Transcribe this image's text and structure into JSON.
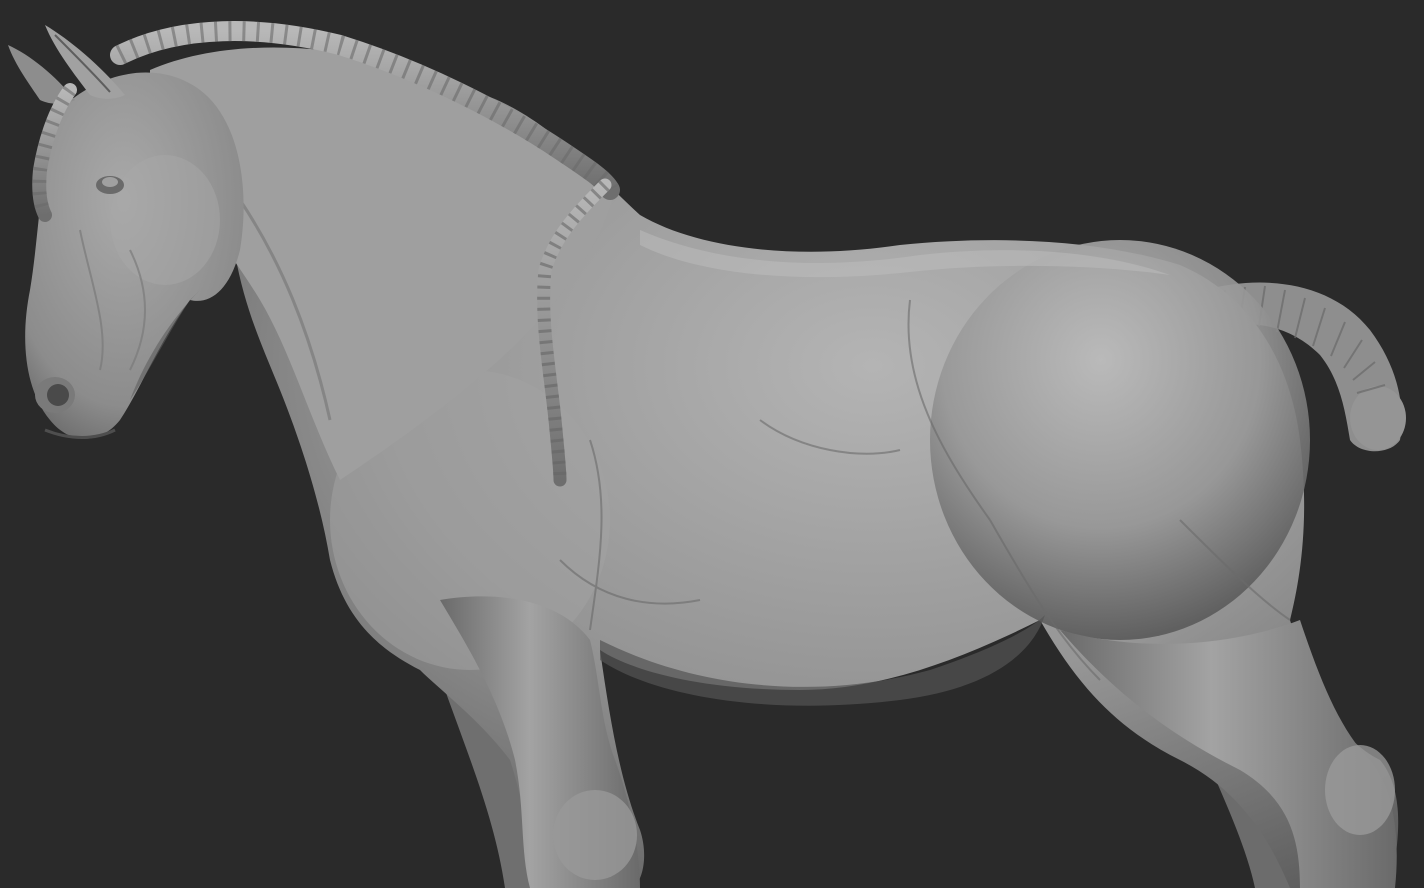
{
  "scene": {
    "subject": "horse-sculpt",
    "background_color": "#2a2a2a",
    "material_color": "#9a9a9a",
    "highlight_color": "#c4c4c4",
    "shadow_color": "#4e4e4e"
  }
}
